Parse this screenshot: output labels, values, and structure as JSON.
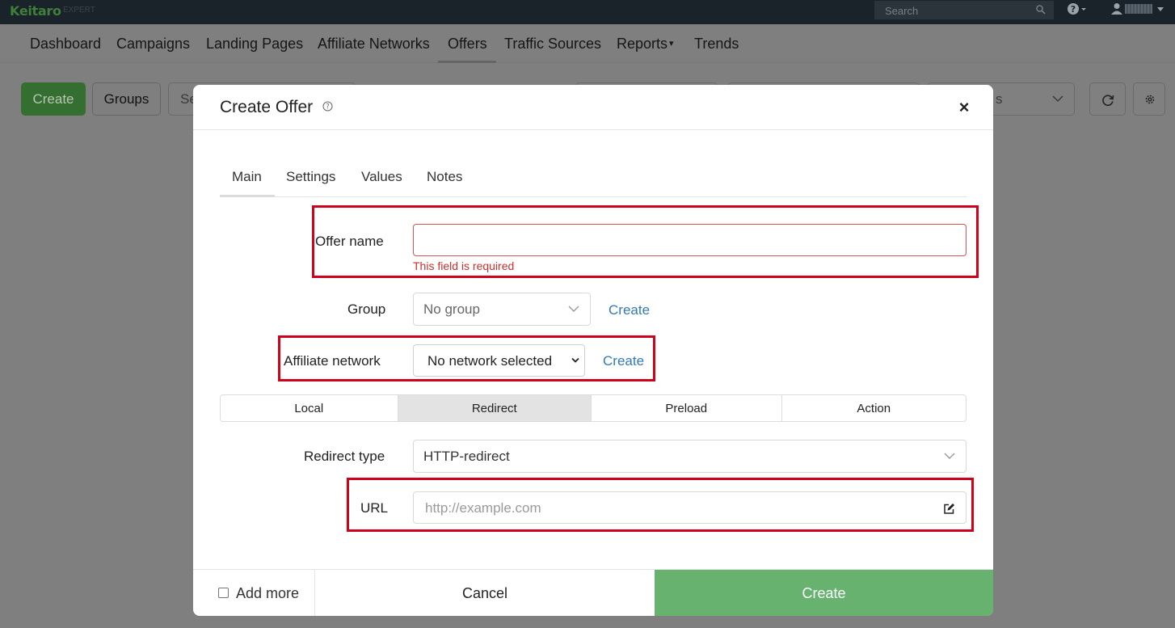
{
  "app": {
    "logo": "Keitaro",
    "edition": "EXPERT",
    "search_placeholder": "Search"
  },
  "nav": {
    "items": [
      "Dashboard",
      "Campaigns",
      "Landing Pages",
      "Affiliate Networks",
      "Offers",
      "Traffic Sources",
      "Reports",
      "Trends"
    ],
    "active": "Offers",
    "reports_caret": "▾"
  },
  "toolbar": {
    "create_label": "Create",
    "groups_label": "Groups",
    "search_partial": "Se",
    "filter_partial": "s"
  },
  "modal": {
    "title": "Create Offer",
    "close_label": "×",
    "tabs": [
      "Main",
      "Settings",
      "Values",
      "Notes"
    ],
    "active_tab": "Main",
    "offer_name": {
      "label": "Offer name",
      "value": "",
      "error": "This field is required"
    },
    "group": {
      "label": "Group",
      "value": "No group",
      "create_link": "Create"
    },
    "affiliate_network": {
      "label": "Affiliate network",
      "value": "No network selected",
      "create_link": "Create"
    },
    "modes": [
      "Local",
      "Redirect",
      "Preload",
      "Action"
    ],
    "active_mode": "Redirect",
    "redirect_type": {
      "label": "Redirect type",
      "value": "HTTP-redirect"
    },
    "url": {
      "label": "URL",
      "placeholder": "http://example.com",
      "value": ""
    },
    "footer": {
      "add_more_label": "Add more",
      "add_more_checked": false,
      "cancel_label": "Cancel",
      "create_label": "Create"
    }
  },
  "colors": {
    "primary_green": "#67b26f",
    "link_blue": "#337ab7",
    "error_red": "#c9302c",
    "annotation_red": "#d0021b",
    "topbar": "#1a232a"
  },
  "icons": [
    "search-icon",
    "help-icon",
    "user-icon",
    "refresh-icon",
    "gear-icon",
    "chevron-down-icon",
    "edit-icon",
    "close-icon"
  ]
}
